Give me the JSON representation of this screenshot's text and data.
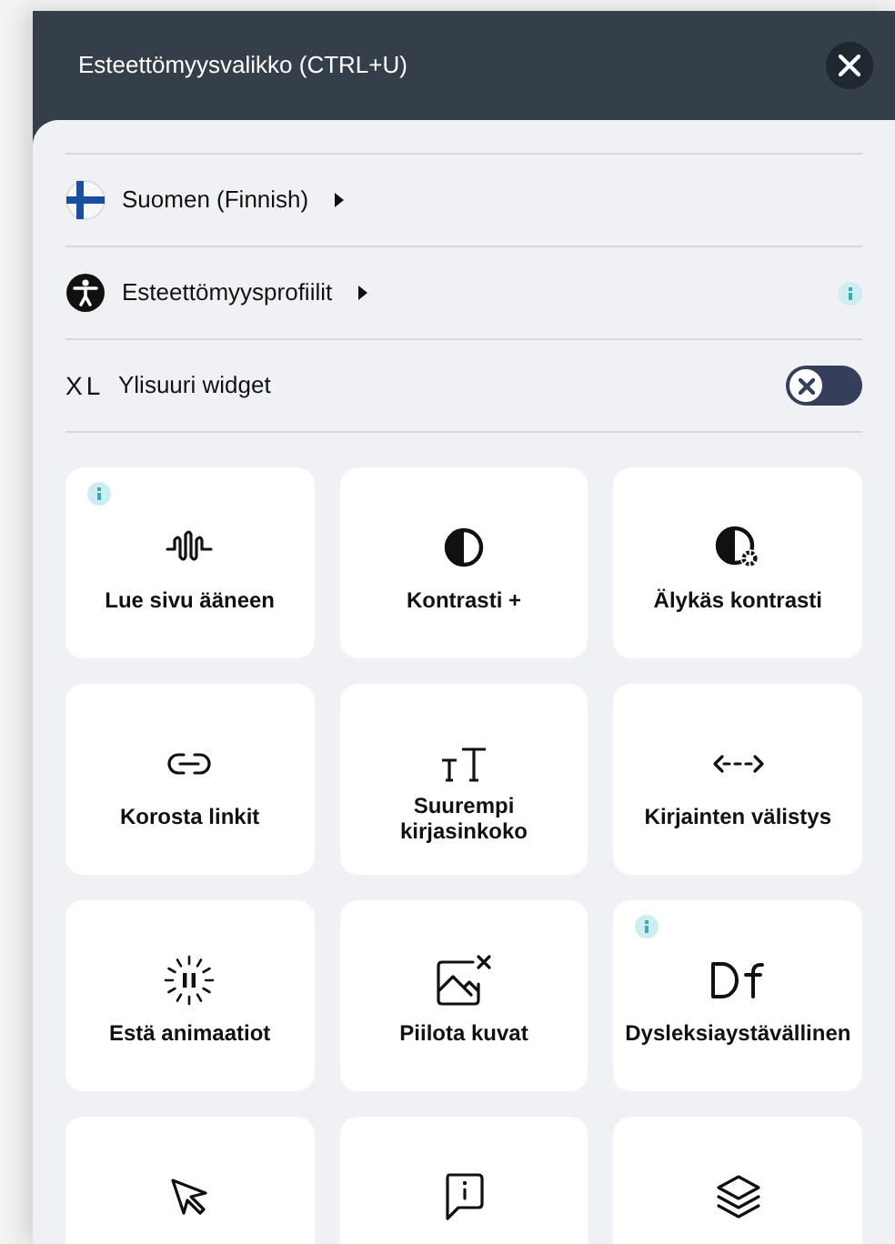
{
  "header": {
    "title": "Esteettömyysvalikko (CTRL+U)"
  },
  "menu_rows": [
    {
      "kind": "language",
      "label": "Suomen (Finnish)",
      "info": false
    },
    {
      "kind": "profiles",
      "label": "Esteettömyysprofiilit",
      "info": true
    }
  ],
  "oversize_widget": {
    "badge": "XL",
    "label": "Ylisuuri widget",
    "on": false
  },
  "tiles": [
    {
      "kind": "wave",
      "label": "Lue sivu ääneen",
      "info": true
    },
    {
      "kind": "contrast",
      "label": "Kontrasti +",
      "info": false
    },
    {
      "kind": "smart-contrast",
      "label": "Älykäs kontrasti",
      "info": false
    },
    {
      "kind": "link",
      "label": "Korosta linkit",
      "info": false
    },
    {
      "kind": "text-size",
      "label": "Suurempi kirjasinkoko",
      "info": false
    },
    {
      "kind": "spacing",
      "label": "Kirjainten välistys",
      "info": false
    },
    {
      "kind": "pause",
      "label": "Estä animaatiot",
      "info": false
    },
    {
      "kind": "hide-image",
      "label": "Piilota kuvat",
      "info": false
    },
    {
      "kind": "dyslexia",
      "label": "Dysleksiaystävällinen",
      "info": true
    },
    {
      "kind": "cursor",
      "info": false
    },
    {
      "kind": "tooltip",
      "info": false
    },
    {
      "kind": "layers",
      "info": false
    }
  ]
}
